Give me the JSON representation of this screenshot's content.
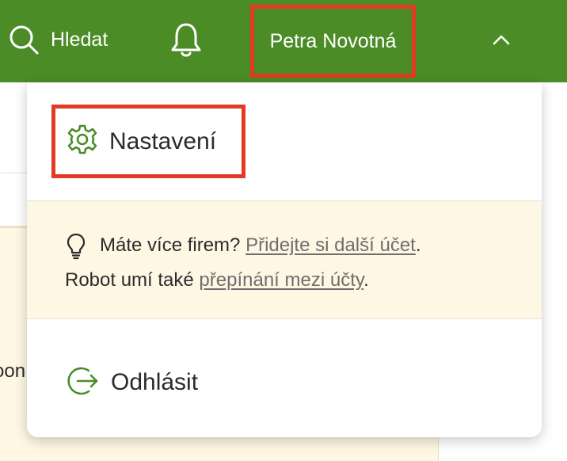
{
  "header": {
    "search_label": "Hledat",
    "user_name": "Petra Novotná"
  },
  "menu": {
    "settings_label": "Nastavení",
    "tip": {
      "line1_text": "Máte více firem? ",
      "line1_link": "Přidejte si další účet",
      "line1_end": ".",
      "line2_text": "Robot umí také ",
      "line2_link": "přepínání mezi účty",
      "line2_end": "."
    },
    "logout_label": "Odhlásit"
  },
  "background": {
    "fragment": "oon"
  },
  "icons": {
    "search": "search-icon",
    "bell": "bell-icon",
    "chevron": "chevron-up-icon",
    "settings": "gear-icon",
    "tip": "lightbulb-icon",
    "logout": "logout-icon"
  },
  "colors": {
    "header_bg": "#4c8c27",
    "accent_green": "#4c8c27",
    "highlight_red": "#e23a23",
    "tip_bg": "#fdf7e4",
    "link_gray": "#6e6e6e"
  }
}
